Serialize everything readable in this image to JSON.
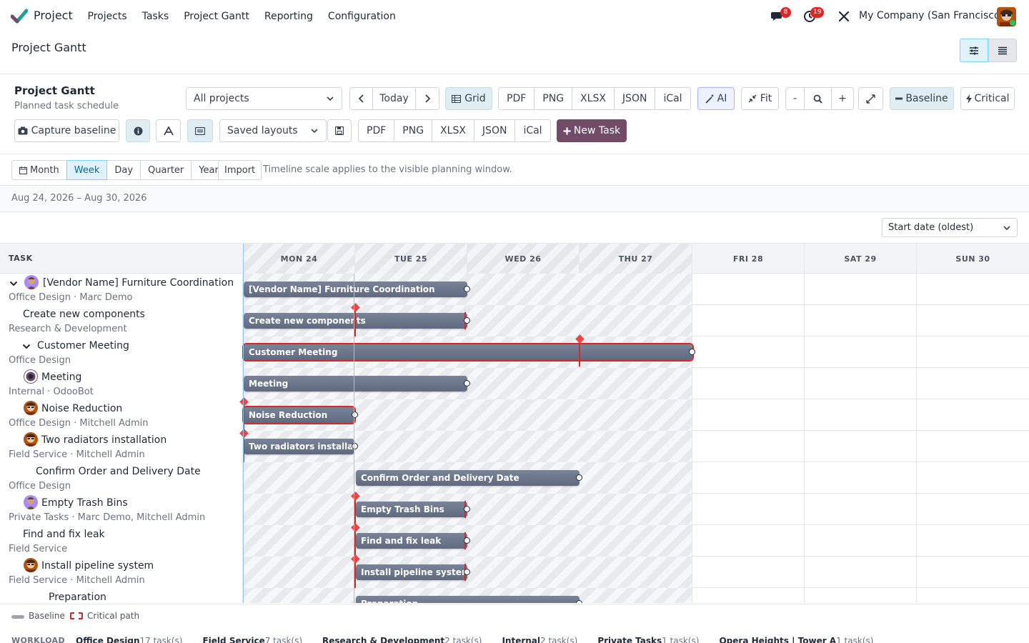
{
  "app": {
    "name": "Project",
    "menu": [
      "Projects",
      "Tasks",
      "Project Gantt",
      "Reporting",
      "Configuration"
    ],
    "messages_count": "8",
    "activities_count": "19",
    "company": "My Company (San Francisco)"
  },
  "breadcrumb": "Project Gantt",
  "toolbar": {
    "title": "Project Gantt",
    "subtitle": "Planned task schedule",
    "project_filter": "All projects",
    "today": "Today",
    "grid": "Grid",
    "export_row1": [
      "PDF",
      "PNG",
      "XLSX",
      "JSON",
      "iCal"
    ],
    "ai": "AI",
    "fit": "Fit",
    "zoom_out": "-",
    "zoom_in": "+",
    "baseline": "Baseline",
    "critical": "Critical",
    "capture_baseline": "Capture baseline",
    "saved_layouts": "Saved layouts",
    "export_row2": [
      "PDF",
      "PNG",
      "XLSX",
      "JSON",
      "iCal"
    ],
    "new_task": "New Task"
  },
  "scale": {
    "options": [
      "Month",
      "Week",
      "Day",
      "Quarter",
      "Year"
    ],
    "active": "Week",
    "import": "Import",
    "note": "Timeline scale applies to the visible planning window."
  },
  "date_range": "Aug 24, 2026 – Aug 30, 2026",
  "sort": "Start date (oldest)",
  "gantt": {
    "task_header": "TASK",
    "days": [
      "MON 24",
      "TUE 25",
      "WED 26",
      "THU 27",
      "FRI 28",
      "SAT 29",
      "SUN 30"
    ],
    "rows": [
      {
        "title": "[Vendor Name] Furniture Coordination",
        "sub": "Office Design · Marc Demo",
        "bar": "[Vendor Name] Furniture Coordination"
      },
      {
        "title": "Create new components",
        "sub": "Research & Development",
        "bar": "Create new components"
      },
      {
        "title": "Customer Meeting",
        "sub": "Office Design",
        "bar": "Customer Meeting"
      },
      {
        "title": "Meeting",
        "sub": "Internal · OdooBot",
        "bar": "Meeting"
      },
      {
        "title": "Noise Reduction",
        "sub": "Office Design · Mitchell Admin",
        "bar": "Noise Reduction"
      },
      {
        "title": "Two radiators installation",
        "sub": "Field Service · Mitchell Admin",
        "bar": "Two radiators installation"
      },
      {
        "title": "Confirm Order and Delivery Date",
        "sub": "Office Design",
        "bar": "Confirm Order and Delivery Date"
      },
      {
        "title": "Empty Trash Bins",
        "sub": "Private Tasks · Marc Demo, Mitchell Admin",
        "bar": "Empty Trash Bins"
      },
      {
        "title": "Find and fix leak",
        "sub": "Field Service",
        "bar": "Find and fix leak"
      },
      {
        "title": "Install pipeline system",
        "sub": "Field Service · Mitchell Admin",
        "bar": "Install pipeline system"
      },
      {
        "title": "Preparation",
        "sub": "",
        "bar": "Preparation"
      }
    ]
  },
  "legend": {
    "baseline": "Baseline",
    "critical": "Critical path"
  },
  "workload": {
    "title": "WORKLOAD",
    "items": [
      {
        "name": "Office Design",
        "count": "17 task(s)"
      },
      {
        "name": "Field Service",
        "count": "7 task(s)"
      },
      {
        "name": "Research & Development",
        "count": "2 task(s)"
      },
      {
        "name": "Internal",
        "count": "2 task(s)"
      },
      {
        "name": "Private Tasks",
        "count": "1 task(s)"
      },
      {
        "name": "Opera Heights | Tower A",
        "count": "1 task(s)"
      }
    ]
  },
  "colors": {
    "brand": "#714b67",
    "bar": "#5f6a80",
    "critical": "#dc2626",
    "active": "#e0f2fe"
  }
}
